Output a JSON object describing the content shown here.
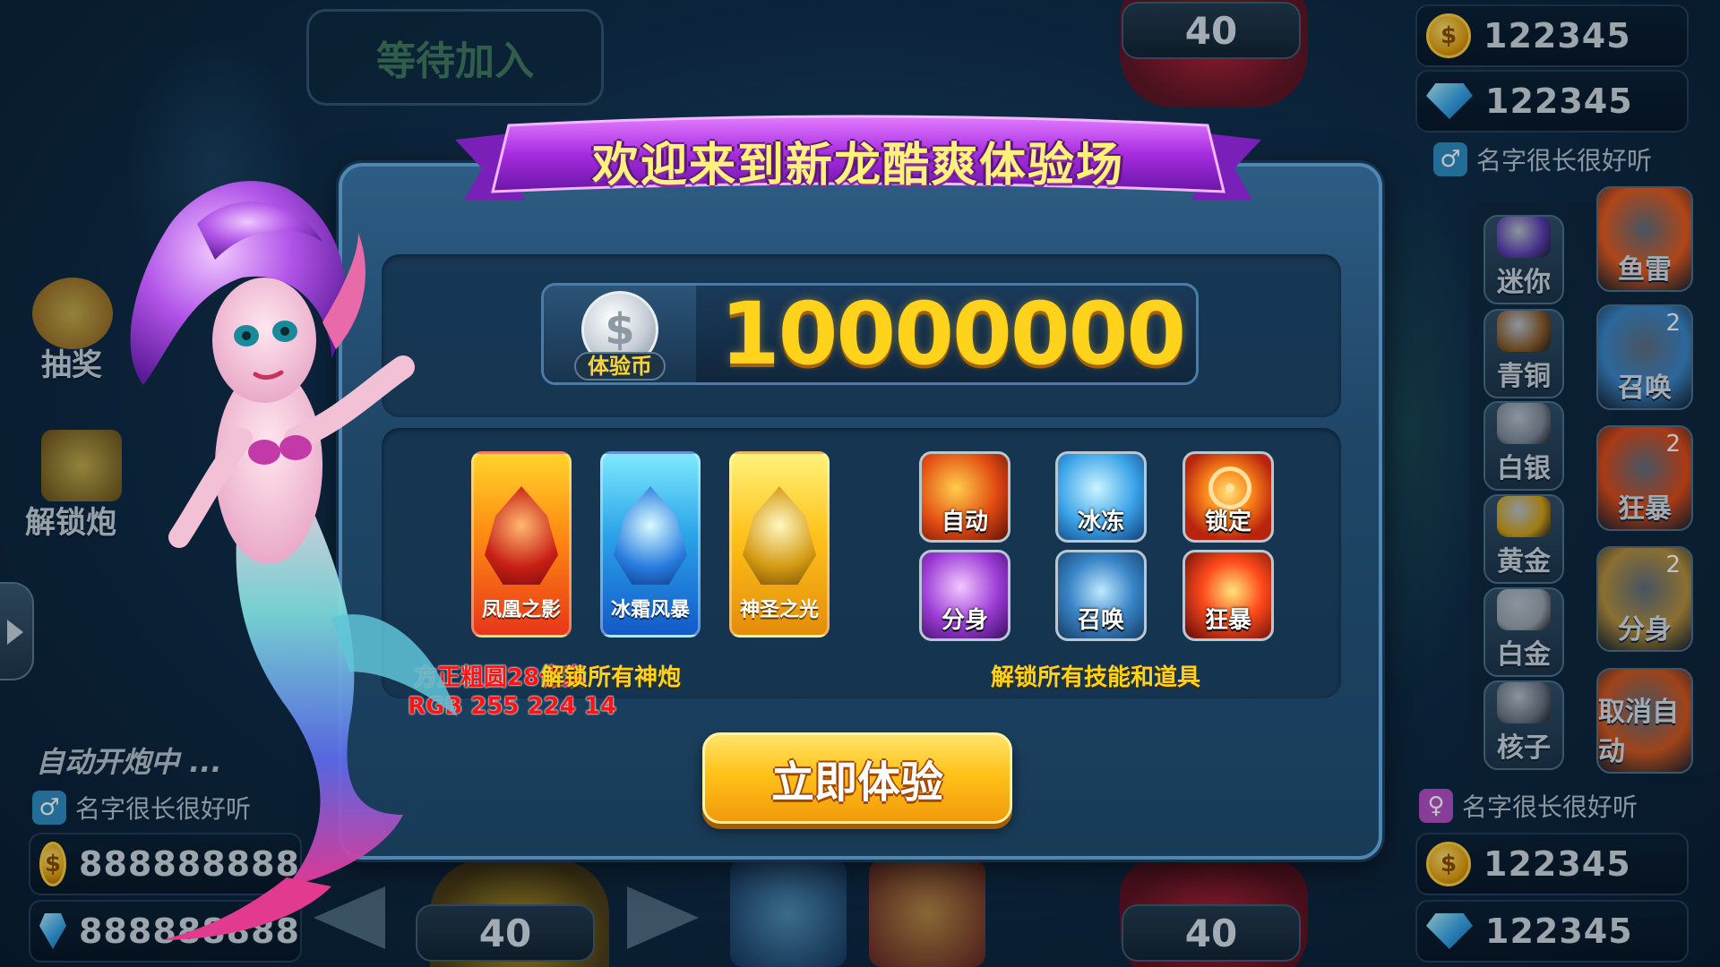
{
  "hud": {
    "waiting_label": "等待加入",
    "top_level": "40",
    "bottom_left_level": "40",
    "bottom_right_level": "40",
    "top_right_player": {
      "coins": "122345",
      "gems": "122345",
      "name": "名字很长很好听",
      "gender": "male"
    },
    "bottom_right_player": {
      "coins": "122345",
      "gems": "122345",
      "name": "名字很长很好听",
      "gender": "female"
    },
    "bottom_left_player": {
      "coins": "888888888",
      "gems": "888888888",
      "name": "名字很长很好听",
      "gender": "male"
    },
    "auto_fire_status": "自动开炮中 ...",
    "left_menu": {
      "lottery": "抽奖",
      "unlock_cannon": "解锁炮"
    }
  },
  "side_items": [
    {
      "label": "迷你",
      "color": "#5a3ab0"
    },
    {
      "label": "青铜",
      "color": "#8a5a24"
    },
    {
      "label": "白银",
      "color": "#7d8a96"
    },
    {
      "label": "黄金",
      "color": "#d4a012"
    },
    {
      "label": "白金",
      "color": "#9aa4ac"
    },
    {
      "label": "核子",
      "color": "#6a7480"
    }
  ],
  "side_skills": [
    {
      "label": "鱼雷",
      "count": "",
      "color": "#e85a1a"
    },
    {
      "label": "召唤",
      "count": "2",
      "color": "#3a86c8"
    },
    {
      "label": "狂暴",
      "count": "2",
      "color": "#e04a14"
    },
    {
      "label": "分身",
      "count": "2",
      "color": "#b8903a"
    },
    {
      "label": "取消自动",
      "count": "",
      "color": "#d4561a"
    }
  ],
  "modal": {
    "title": "欢迎来到新龙酷爽体验场",
    "balance_tag": "体验币",
    "balance_value": "10000000",
    "cannons": [
      {
        "label": "凤凰之影",
        "style": "phoenix"
      },
      {
        "label": "冰霜风暴",
        "style": "frost"
      },
      {
        "label": "神圣之光",
        "style": "holy"
      }
    ],
    "cannons_caption": "解锁所有神炮",
    "skills": [
      {
        "label": "自动"
      },
      {
        "label": "冰冻"
      },
      {
        "label": "锁定"
      },
      {
        "label": "分身"
      },
      {
        "label": "召唤"
      },
      {
        "label": "狂暴"
      }
    ],
    "skills_caption": "解锁所有技能和道具",
    "annotation_font": "方正粗圆28像素",
    "annotation_color": "RGB 255 224 14",
    "cta_label": "立即体验"
  },
  "colors": {
    "title_text": "#fff27a",
    "banner_purple": "#b23ad8",
    "balance_gold": "#ffd21c",
    "caption_gold": "#ffe00e",
    "annotation_red": "#ff1414"
  }
}
